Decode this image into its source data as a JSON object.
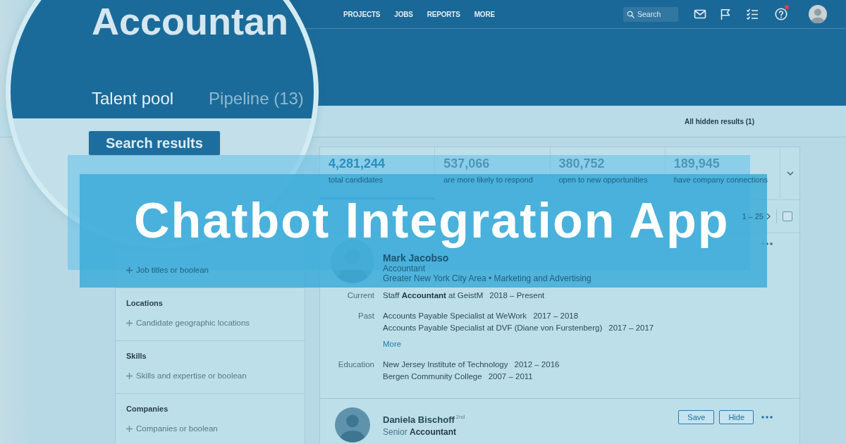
{
  "nav": {
    "links": [
      "PROJECTS",
      "JOBS",
      "REPORTS",
      "MORE"
    ],
    "search": {
      "placeholder": "Search"
    },
    "alert": true
  },
  "lens": {
    "title": "Accountan",
    "tabs": [
      {
        "label": "Talent pool",
        "selected": true
      },
      {
        "label": "Pipeline (13)",
        "selected": false
      }
    ],
    "button": "Search results"
  },
  "hidden_results": "All hidden results (1)",
  "filters": [
    {
      "add": "Job titles or boolean"
    },
    {
      "title": "Locations",
      "add": "Candidate geographic locations"
    },
    {
      "title": "Skills",
      "add": "Skills and expertise or boolean"
    },
    {
      "title": "Companies",
      "add": "Companies or boolean"
    }
  ],
  "stats": [
    {
      "value": "4,281,244",
      "label": "total candidates",
      "selected": true
    },
    {
      "value": "537,066",
      "label": "are more likely to respond",
      "selected": false
    },
    {
      "value": "380,752",
      "label": "open to new opportunities",
      "selected": false
    },
    {
      "value": "189,945",
      "label": "have company connections",
      "selected": false
    }
  ],
  "pagination": {
    "range": "1 – 25",
    "checked": false
  },
  "candidates": [
    {
      "name": "Mark Jacobso",
      "headline": "Accountant",
      "location": "Greater New York City Area • Marketing and Advertising",
      "details": [
        {
          "label": "Current",
          "entries": [
            {
              "text": "Staff **Accountant** at GeistM",
              "dates": "2018 – Present"
            }
          ]
        },
        {
          "label": "Past",
          "entries": [
            {
              "text": "Accounts Payable Specialist at WeWork",
              "dates": "2017 – 2018"
            },
            {
              "text": "Accounts Payable Specialist at DVF (Diane von Furstenberg)",
              "dates": "2017 – 2017"
            }
          ],
          "more": "More"
        },
        {
          "label": "Education",
          "entries": [
            {
              "text": "New Jersey Institute of Technology",
              "dates": "2012 – 2016"
            },
            {
              "text": "Bergen Community College",
              "dates": "2007 – 2011"
            }
          ]
        }
      ]
    },
    {
      "name": "Daniela Bischoff",
      "degree": "2nd",
      "headline": "Senior **Accountant**",
      "actions": {
        "save": "Save",
        "hide": "Hide"
      }
    }
  ],
  "banner": {
    "title": "Chatbot Integration App"
  }
}
